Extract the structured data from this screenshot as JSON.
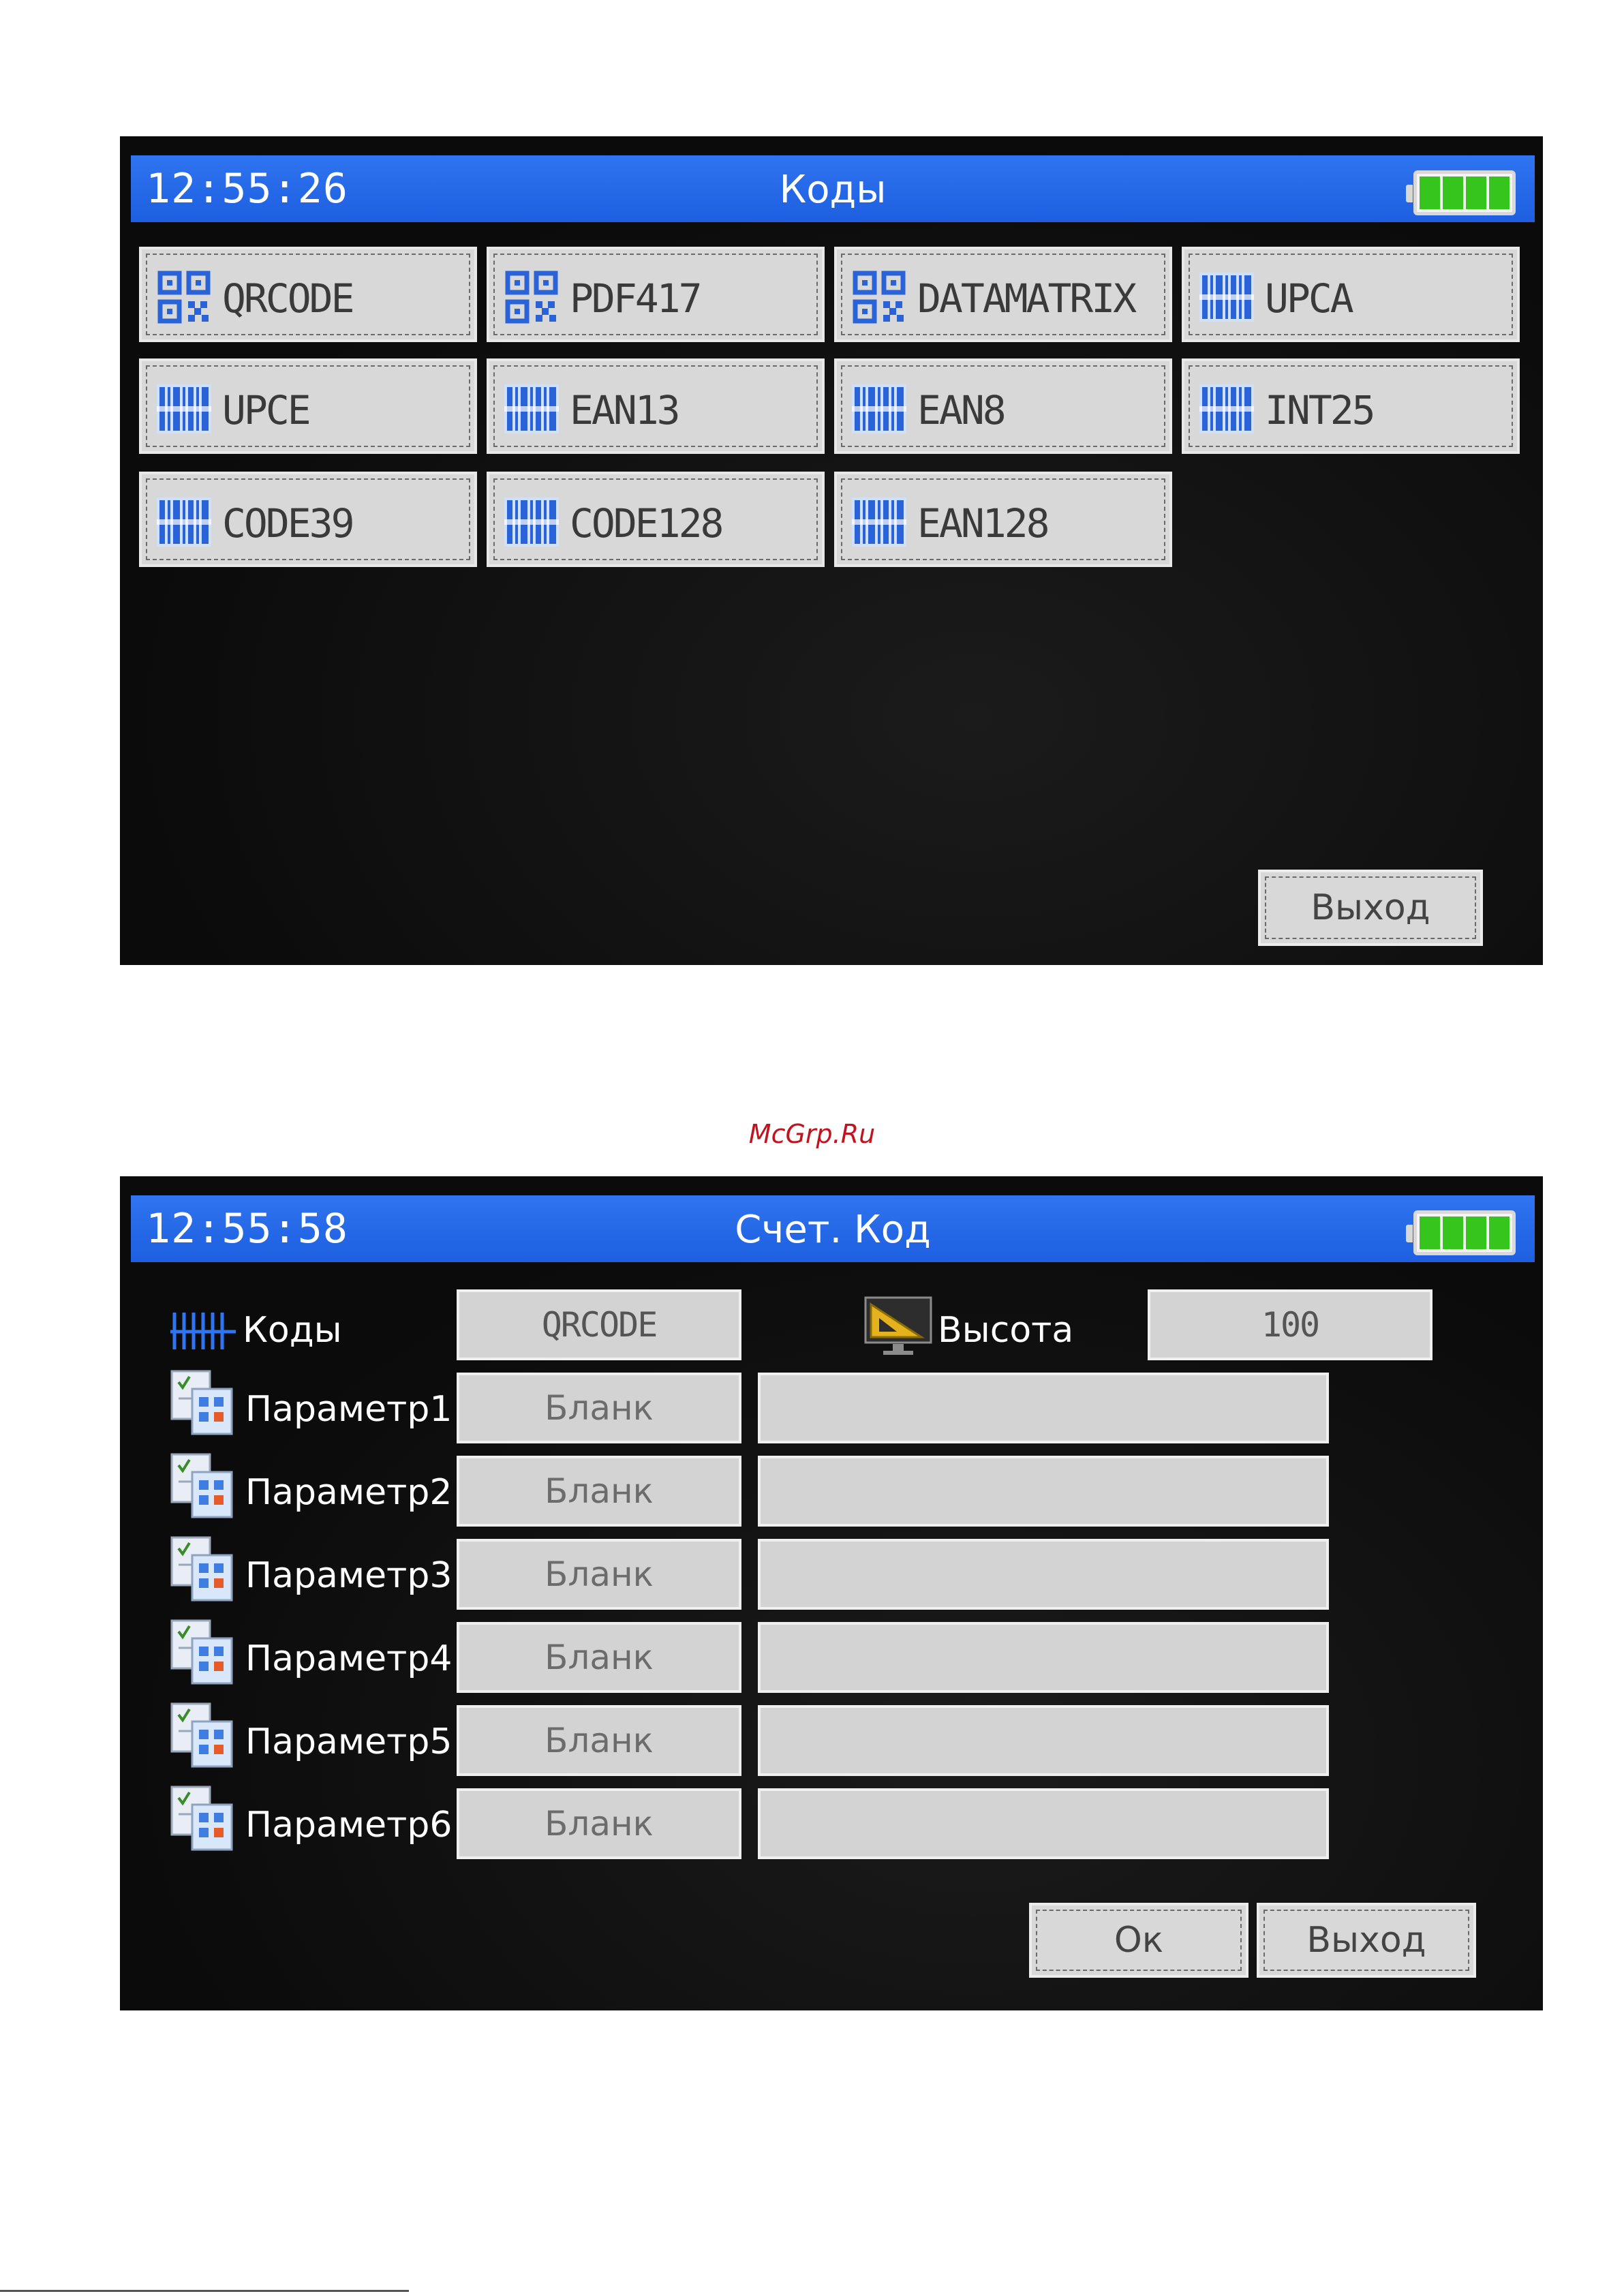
{
  "watermark": "McGrp.Ru",
  "colors": {
    "titlebar": "#2f74f0",
    "battery_fill": "#36c51d",
    "tile_bg": "#d8d8d8",
    "icon_blue": "#2a63d8"
  },
  "screen1": {
    "time": "12:55:26",
    "title": "Коды",
    "tiles": [
      {
        "label": "QRCODE",
        "icon": "qr-icon"
      },
      {
        "label": "PDF417",
        "icon": "qr-icon"
      },
      {
        "label": "DATAMATRIX",
        "icon": "qr-icon"
      },
      {
        "label": "UPCA",
        "icon": "barcode-icon"
      },
      {
        "label": "UPCE",
        "icon": "barcode-icon"
      },
      {
        "label": "EAN13",
        "icon": "barcode-icon"
      },
      {
        "label": "EAN8",
        "icon": "barcode-icon"
      },
      {
        "label": "INT25",
        "icon": "barcode-icon"
      },
      {
        "label": "CODE39",
        "icon": "barcode-icon"
      },
      {
        "label": "CODE128",
        "icon": "barcode-icon"
      },
      {
        "label": "EAN128",
        "icon": "barcode-icon"
      }
    ],
    "exit_label": "Выход"
  },
  "screen2": {
    "time": "12:55:58",
    "title": "Счет. Код",
    "codes_label": "Коды",
    "codes_value": "QRCODE",
    "height_label": "Высота",
    "height_value": "100",
    "params": [
      {
        "label": "Параметр1",
        "type": "Бланк",
        "value": ""
      },
      {
        "label": "Параметр2",
        "type": "Бланк",
        "value": ""
      },
      {
        "label": "Параметр3",
        "type": "Бланк",
        "value": ""
      },
      {
        "label": "Параметр4",
        "type": "Бланк",
        "value": ""
      },
      {
        "label": "Параметр5",
        "type": "Бланк",
        "value": ""
      },
      {
        "label": "Параметр6",
        "type": "Бланк",
        "value": ""
      }
    ],
    "ok_label": "Ок",
    "exit_label": "Выход"
  }
}
